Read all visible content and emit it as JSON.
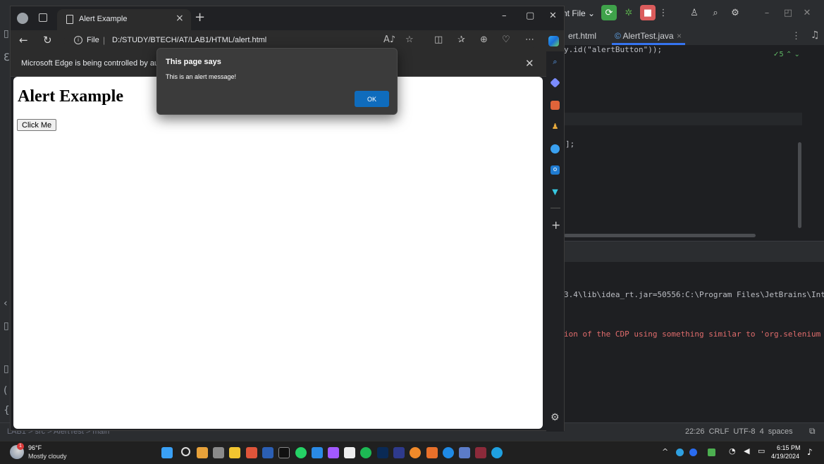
{
  "ide": {
    "run_config_label": "nt File ⌄",
    "editor_tabs": [
      "ert.html",
      "AlertTest.java"
    ],
    "code_line_1": "y.id(\"alertButton\"));",
    "code_line_2": "];",
    "warning_count": "5",
    "console_line_1": "3.4\\lib\\idea_rt.jar=50556:C:\\Program Files\\JetBrains\\Int",
    "console_line_2": "ion of the CDP using something similar to 'org.selenium",
    "breadcrumb": "LAB1 > src > AlertTest > main",
    "status_right": "22:26  CRLF  UTF-8  4 spaces",
    "colors": {
      "run_green": "#3fa24a",
      "stop_red": "#db5c5c",
      "string_green": "#6aab73",
      "error_red": "#e06c6c"
    }
  },
  "browser": {
    "tab_title": "Alert Example",
    "site_label": "File",
    "url": "D:/STUDY/BTECH/AT/LAB1/HTML/alert.html",
    "infobar_text": "Microsoft Edge is being controlled by autom",
    "toolbar_icons": [
      "back-icon",
      "refresh-icon",
      "read-aloud-icon",
      "favorite-add-icon",
      "split-screen-icon",
      "favorites-icon",
      "collections-icon",
      "browser-essentials-icon",
      "more-icon",
      "copilot-icon"
    ]
  },
  "page": {
    "heading": "Alert Example",
    "button_label": "Click Me"
  },
  "alert": {
    "title": "This page says",
    "message": "This is an alert message!",
    "ok_label": "OK",
    "ok_color": "#0f6cbd"
  },
  "taskbar": {
    "weather_temp": "96°F",
    "weather_condition": "Mostly cloudy",
    "weather_badge": "1",
    "time": "6:15 PM",
    "date": "4/19/2024"
  }
}
